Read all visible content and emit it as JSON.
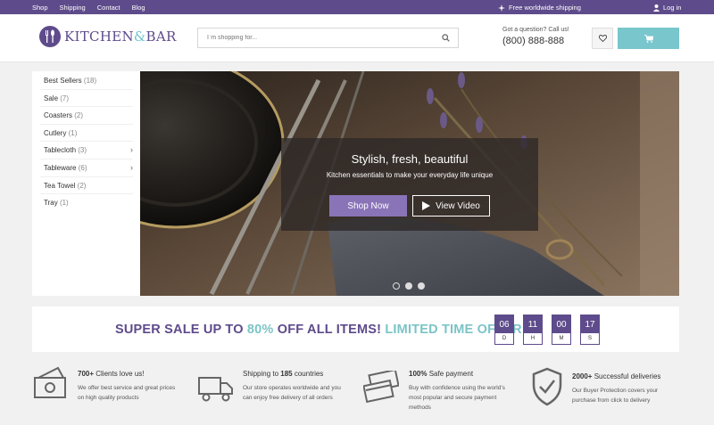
{
  "topbar": {
    "nav": [
      "Shop",
      "Shipping",
      "Contact",
      "Blog"
    ],
    "shipping_text": "Free worldwide shipping",
    "login": "Log in"
  },
  "header": {
    "logo_kitchen": "KITCHEN",
    "logo_amp": "&",
    "logo_bar": "BAR",
    "search_placeholder": "I`m shopping for...",
    "contact_question": "Got a question? Call us!",
    "phone": "(800) 888-888"
  },
  "sidebar": {
    "items": [
      {
        "label": "Best Sellers",
        "count": "(18)"
      },
      {
        "label": "Sale",
        "count": "(7)"
      },
      {
        "label": "Coasters",
        "count": "(2)"
      },
      {
        "label": "Cutlery",
        "count": "(1)"
      },
      {
        "label": "Tablecloth",
        "count": "(3)"
      },
      {
        "label": "Tableware",
        "count": "(6)"
      },
      {
        "label": "Tea Towel",
        "count": "(2)"
      },
      {
        "label": "Tray",
        "count": "(1)"
      }
    ]
  },
  "hero": {
    "headline": "Stylish, fresh, beautiful",
    "subtitle": "Kitchen essentials to make your everyday life unique",
    "shop_button": "Shop Now",
    "video_button": "View Video",
    "slides": 3,
    "active_slide": 1
  },
  "sale": {
    "part1": "SUPER SALE UP TO ",
    "percent": "80%",
    "part2": " OFF ALL ITEMS! ",
    "part3": "LIMITED TIME OFFER",
    "timer": [
      {
        "value": "06",
        "unit": "D"
      },
      {
        "value": "11",
        "unit": "H"
      },
      {
        "value": "00",
        "unit": "M"
      },
      {
        "value": "17",
        "unit": "S"
      }
    ]
  },
  "features": [
    {
      "bold": "700+",
      "title": " Clients love us!",
      "desc": "We offer best service and great prices on high quality products",
      "icon": "money-icon"
    },
    {
      "pre": "Shipping to ",
      "bold": "185",
      "title": " countries",
      "desc": "Our store operates worldwide and you can enjoy free delivery of all orders",
      "icon": "truck-icon"
    },
    {
      "bold": "100%",
      "title": " Safe payment",
      "desc": "Buy with confidence using the world's most popular and secure payment methods",
      "icon": "credit-card-icon"
    },
    {
      "bold": "2000+",
      "title": " Successful deliveries",
      "desc": "Our Buyer Protection covers your purchase from click to delivery",
      "icon": "shield-check-icon"
    }
  ],
  "colors": {
    "brand": "#5e4b8b",
    "accent": "#79c6cc",
    "button": "#8a74b8"
  }
}
